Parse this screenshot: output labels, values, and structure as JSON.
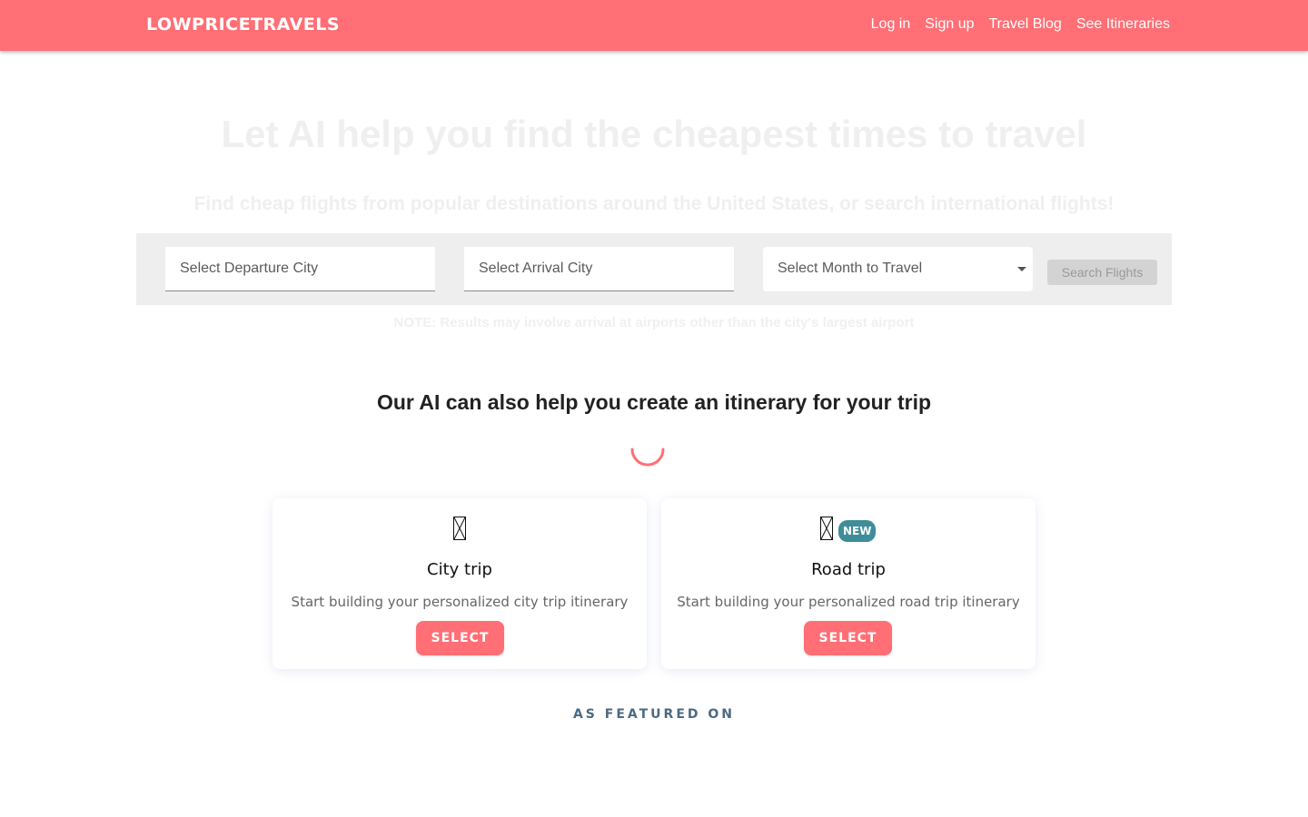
{
  "navbar": {
    "brand": "LOWPRICETRAVELS",
    "links": [
      "Log in",
      "Sign up",
      "Travel Blog",
      "See Itineraries"
    ],
    "color": "#ff6f75"
  },
  "hero": {
    "title": "Let AI help you find the cheapest times to travel",
    "subtitle": "Find cheap flights from popular destinations around the United States, or search international flights!"
  },
  "search": {
    "departure_placeholder": "Select Departure City",
    "arrival_placeholder": "Select Arrival City",
    "month_placeholder": "Select Month to Travel",
    "button_label": "Search Flights",
    "note": "NOTE: Results may involve arrival at airports other than the city's largest airport"
  },
  "itinerary": {
    "heading": "Our AI can also help you create an itinerary for your trip",
    "spinner_icon": "loading-spinner-icon",
    "cards": [
      {
        "icon": "city-icon",
        "title": "City trip",
        "description": "Start building your personalized city trip itinerary",
        "button_label": "SELECT"
      },
      {
        "icon": "car-icon",
        "badge": "NEW",
        "title": "Road trip",
        "description": "Start building your personalized road trip itinerary",
        "button_label": "SELECT"
      }
    ]
  },
  "featured": {
    "label": "AS FEATURED ON"
  },
  "colors": {
    "accent": "#ff6f75",
    "badge": "#3f8c9a",
    "featured_text": "#4d6a80"
  }
}
